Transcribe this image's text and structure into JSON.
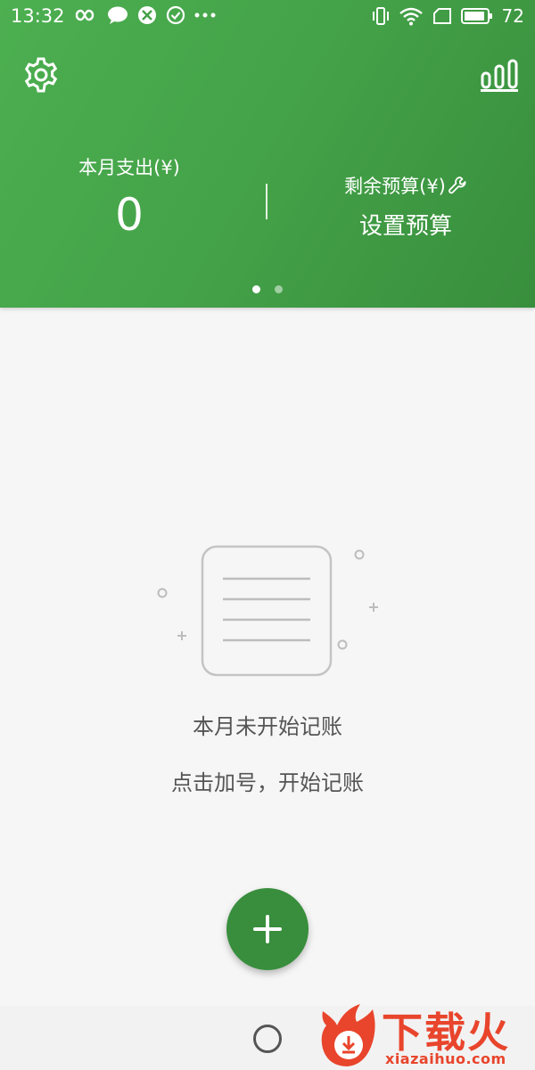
{
  "status_bar": {
    "time": "13:32",
    "battery": "72",
    "icons": [
      "infinity-icon",
      "chat-bubble-icon",
      "share-icon",
      "check-circle-icon",
      "more-dots-icon",
      "vibrate-icon",
      "wifi-icon",
      "sim-icon",
      "battery-icon"
    ]
  },
  "header": {
    "settings_icon": "gear-icon",
    "stats_icon": "bar-chart-icon",
    "expense_label": "本月支出(¥)",
    "expense_value": "0",
    "budget_label": "剩余预算(¥)",
    "budget_icon": "wrench-icon",
    "budget_action": "设置预算",
    "pages": 2,
    "active_page": 1
  },
  "empty_state": {
    "title": "本月未开始记账",
    "hint": "点击加号，开始记账"
  },
  "fab": {
    "icon": "plus-icon"
  },
  "watermark": {
    "brand": "下载火",
    "url": "xiazaihuo.com"
  },
  "colors": {
    "header_green": "#4caf50",
    "fab_green": "#388e3c",
    "watermark_red": "#e8452c"
  }
}
